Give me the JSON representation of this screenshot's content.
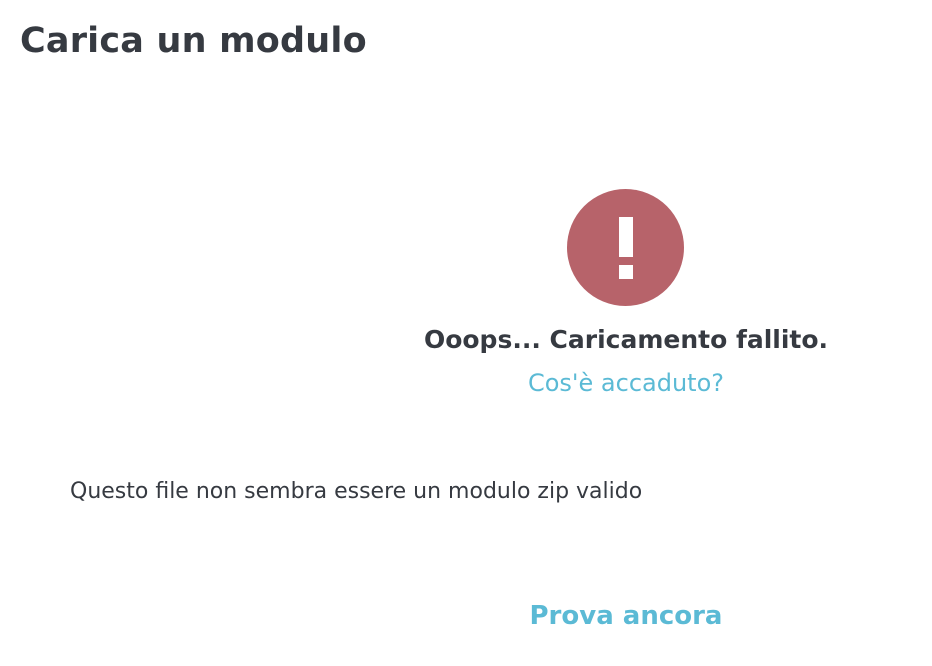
{
  "header": {
    "title": "Carica un modulo"
  },
  "error": {
    "icon": "exclamation-icon",
    "icon_color": "#b7636a",
    "heading": "Ooops... Caricamento fallito.",
    "help_link": "Cos'è accaduto?",
    "message": "Questo file non sembra essere un modulo zip valido"
  },
  "actions": {
    "retry_label": "Prova ancora"
  },
  "colors": {
    "text": "#363a41",
    "link": "#5bbad5"
  }
}
